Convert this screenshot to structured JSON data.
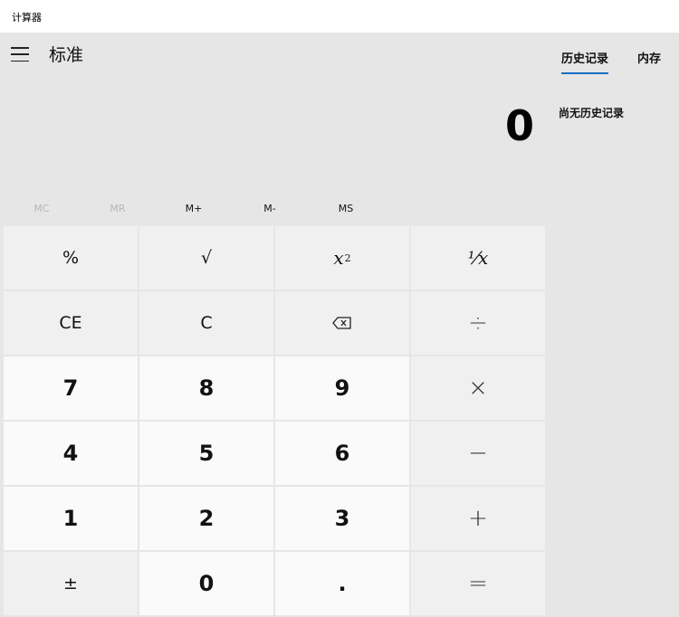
{
  "window": {
    "title": "计算器"
  },
  "header": {
    "mode_title": "标准"
  },
  "display": {
    "value": "0"
  },
  "memory": {
    "buttons": [
      "MC",
      "MR",
      "M+",
      "M-",
      "MS"
    ]
  },
  "keypad": {
    "percent": "%",
    "sqrt": "√",
    "square": "x",
    "square_exp": "2",
    "reciprocal": "⅟x",
    "clear_entry": "CE",
    "clear": "C",
    "backspace_icon": "backspace-icon",
    "divide": "÷",
    "seven": "7",
    "eight": "8",
    "nine": "9",
    "multiply": "×",
    "four": "4",
    "five": "5",
    "six": "6",
    "subtract": "−",
    "one": "1",
    "two": "2",
    "three": "3",
    "add": "+",
    "negate": "±",
    "zero": "0",
    "decimal": ".",
    "equals": "="
  },
  "side_panel": {
    "tabs": [
      "历史记录",
      "内存"
    ],
    "active_tab_color": "#1a6ec4",
    "empty_message": "尚无历史记录"
  }
}
